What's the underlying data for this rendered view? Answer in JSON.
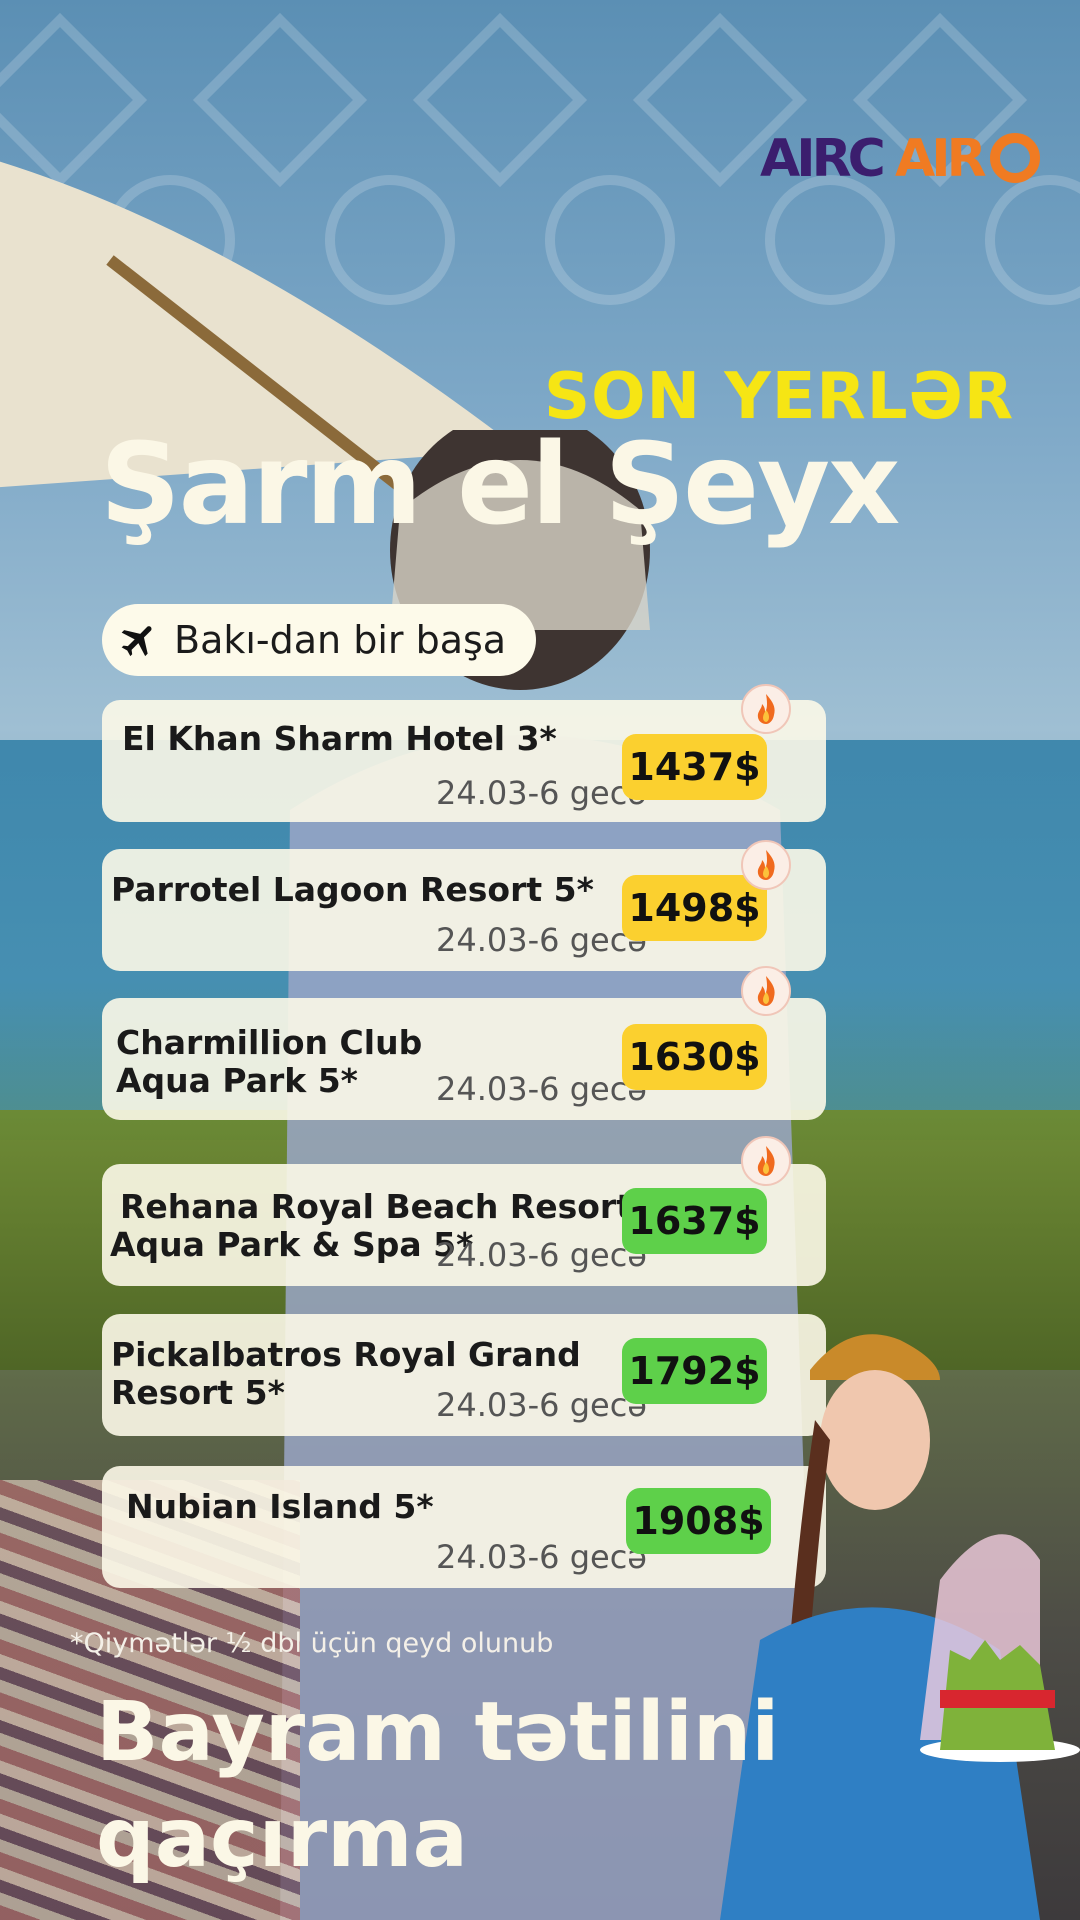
{
  "brand": {
    "logo_text": "AIRCAIRO",
    "colors": {
      "purple": "#3b1e6e",
      "orange": "#f07b22"
    }
  },
  "headline": {
    "tag": "SON YERLƏR",
    "destination": "Şarm el Şeyx"
  },
  "flight": {
    "icon": "airplane-icon",
    "label": "Bakı-dan bir başa"
  },
  "hotels": [
    {
      "name_lines": [
        "El Khan Sharm Hotel 3*"
      ],
      "dates": "24.03-6 gecə",
      "price": "1437$",
      "price_color": "yellow",
      "hot": true
    },
    {
      "name_lines": [
        "Parrotel Lagoon Resort 5*"
      ],
      "dates": "24.03-6 gecə",
      "price": "1498$",
      "price_color": "yellow",
      "hot": true
    },
    {
      "name_lines": [
        "Charmillion Club",
        "Aqua Park 5*"
      ],
      "dates": "24.03-6 gecə",
      "price": "1630$",
      "price_color": "yellow",
      "hot": true
    },
    {
      "name_lines": [
        "Rehana Royal Beach Resort",
        "Aqua Park & Spa 5*"
      ],
      "dates": "24.03-6 gecə",
      "price": "1637$",
      "price_color": "green",
      "hot": true
    },
    {
      "name_lines": [
        "Pickalbatros Royal Grand",
        "Resort 5*"
      ],
      "dates": "24.03-6 gecə",
      "price": "1792$",
      "price_color": "green",
      "hot": false
    },
    {
      "name_lines": [
        "Nubian Island 5*"
      ],
      "dates": "24.03-6 gecə",
      "price": "1908$",
      "price_color": "green",
      "hot": false
    }
  ],
  "footnote": "*Qiymətlər ½ dbl üçün qeyd olunub",
  "slogan": {
    "line1": "Bayram tətilini",
    "line2": "qaçırma"
  },
  "icons": {
    "hot": "fire-icon",
    "plane": "airplane-icon"
  }
}
